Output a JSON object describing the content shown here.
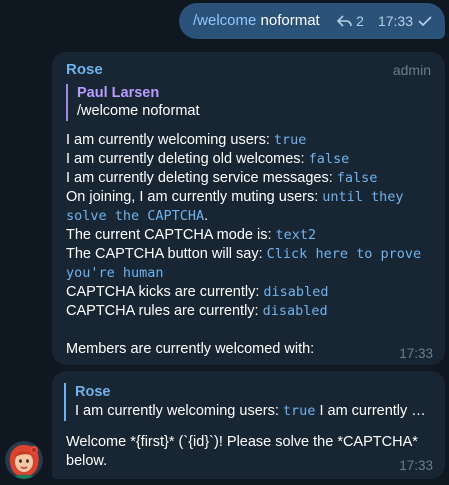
{
  "outgoing": {
    "command": "/welcome",
    "arg": " noformat",
    "replies_count": "2",
    "time": "17:33",
    "reply_icon": "reply-arrow-icon",
    "check_icon": "checkmark-icon"
  },
  "message1": {
    "sender": "Rose",
    "tag": "admin",
    "reply": {
      "name": "Paul Larsen",
      "text": "/welcome noformat"
    },
    "lines": [
      {
        "text": "I am currently welcoming users: ",
        "code": "true"
      },
      {
        "text": "I am currently deleting old welcomes: ",
        "code": "false"
      },
      {
        "text": "I am currently deleting service messages: ",
        "code": "false"
      },
      {
        "text": "On joining, I am currently muting users: ",
        "code": "until they"
      },
      {
        "code_cont": "solve the CAPTCHA",
        "tail": "."
      },
      {
        "text": "The current CAPTCHA mode is: ",
        "code": "text2"
      },
      {
        "text": "The CAPTCHA button will say: ",
        "code": "Click here to prove"
      },
      {
        "code_cont": "you're human"
      },
      {
        "text": "CAPTCHA kicks are currently: ",
        "code": "disabled"
      },
      {
        "text": "CAPTCHA rules are currently: ",
        "code": "disabled"
      }
    ],
    "welcome_text": "Members are currently welcomed with:",
    "time": "17:33"
  },
  "message2": {
    "reply": {
      "name": "Rose",
      "text_prefix": "I am currently welcoming users: ",
      "text_code": "true",
      "text_suffix": " I am currently …"
    },
    "text_line1": "Welcome *{first}* (`{id}`)! Please solve the *CAPTCHA*",
    "text_line2": "below.",
    "time": "17:33"
  },
  "avatar_icon": "rose-avatar-icon",
  "colors": {
    "background": "#0f1720",
    "outgoing_bubble": "#2b5278",
    "incoming_bubble": "#182533",
    "accent": "#6fb3ee",
    "reply_name": "#b99cff"
  }
}
